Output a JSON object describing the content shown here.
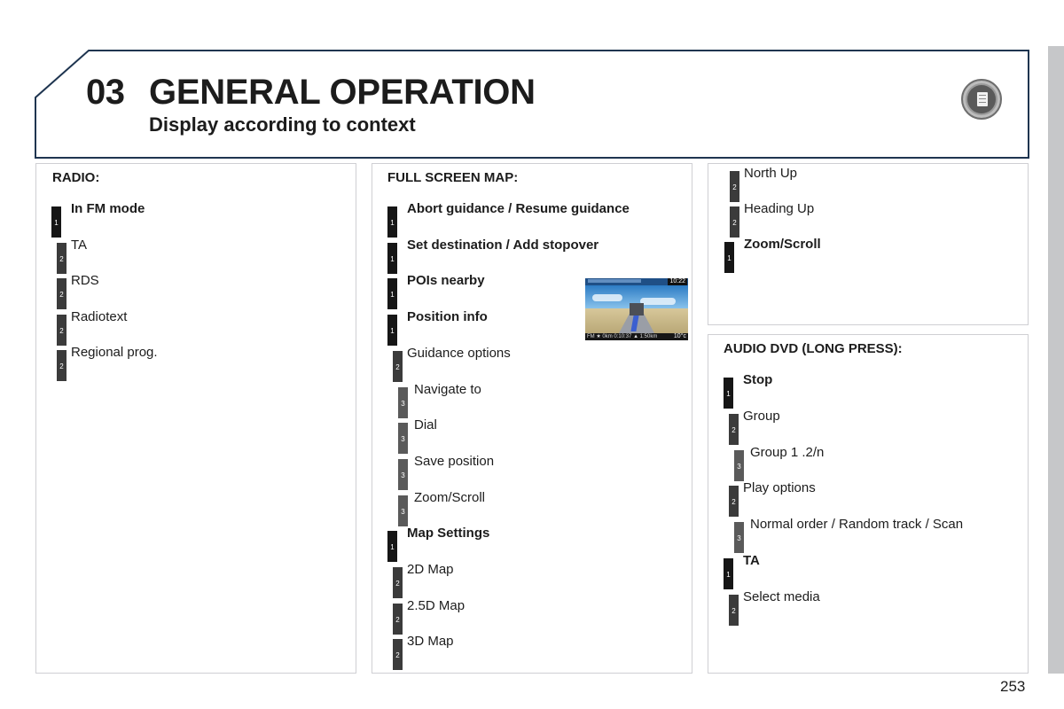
{
  "header": {
    "chapter_number": "03",
    "chapter_title": "GENERAL OPERATION",
    "subtitle": "Display according to context",
    "section_icon": "document-icon"
  },
  "panels": {
    "radio": {
      "title": "RADIO:",
      "items": [
        {
          "level": "1",
          "label": "In FM mode",
          "bold": true
        },
        {
          "level": "2",
          "label": "TA",
          "bold": false
        },
        {
          "level": "2",
          "label": "RDS",
          "bold": false
        },
        {
          "level": "2",
          "label": "Radiotext",
          "bold": false
        },
        {
          "level": "2",
          "label": "Regional prog.",
          "bold": false
        }
      ]
    },
    "full_screen_map": {
      "title": "FULL SCREEN MAP:",
      "items": [
        {
          "level": "1",
          "label": "Abort guidance / Resume guidance",
          "bold": true
        },
        {
          "level": "1",
          "label": "Set destination / Add stopover",
          "bold": true
        },
        {
          "level": "1",
          "label": "POIs nearby",
          "bold": true
        },
        {
          "level": "1",
          "label": "Position info",
          "bold": true
        },
        {
          "level": "2",
          "label": "Guidance options",
          "bold": false
        },
        {
          "level": "3",
          "label": "Navigate to",
          "bold": false
        },
        {
          "level": "3",
          "label": "Dial",
          "bold": false
        },
        {
          "level": "3",
          "label": "Save position",
          "bold": false
        },
        {
          "level": "3",
          "label": "Zoom/Scroll",
          "bold": false
        },
        {
          "level": "1",
          "label": "Map Settings",
          "bold": true
        },
        {
          "level": "2",
          "label": "2D Map",
          "bold": false
        },
        {
          "level": "2",
          "label": "2.5D Map",
          "bold": false
        },
        {
          "level": "2",
          "label": "3D Map",
          "bold": false
        }
      ],
      "thumbnail": {
        "clock": "10:22",
        "status_left": "FM   ★   0km 0:10:37   ▲ 1:50km",
        "temperature": "10°c"
      }
    },
    "map_continued": {
      "items": [
        {
          "level": "2",
          "label": "North Up",
          "bold": false
        },
        {
          "level": "2",
          "label": "Heading Up",
          "bold": false
        },
        {
          "level": "1",
          "label": "Zoom/Scroll",
          "bold": true
        }
      ]
    },
    "audio_dvd": {
      "title": "AUDIO DVD (LONG PRESS):",
      "items": [
        {
          "level": "1",
          "label": "Stop",
          "bold": true
        },
        {
          "level": "2",
          "label": "Group",
          "bold": false
        },
        {
          "level": "3",
          "label": "Group 1 .2/n",
          "bold": false
        },
        {
          "level": "2",
          "label": "Play options",
          "bold": false
        },
        {
          "level": "3",
          "label": "Normal order / Random track / Scan",
          "bold": false
        },
        {
          "level": "1",
          "label": "TA",
          "bold": true
        },
        {
          "level": "2",
          "label": "Select media",
          "bold": false
        }
      ]
    }
  },
  "footer": {
    "page_number": "253"
  }
}
